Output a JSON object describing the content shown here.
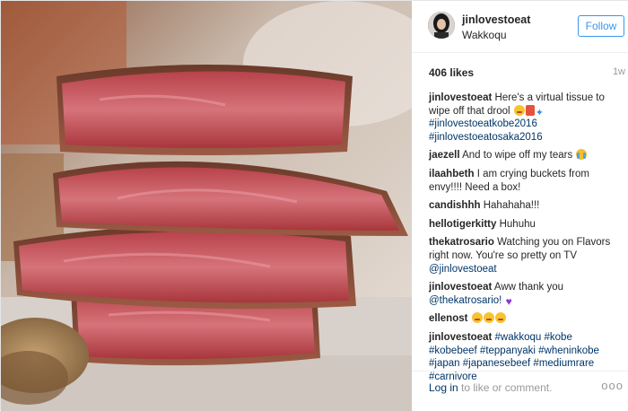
{
  "header": {
    "username": "jinlovestoeat",
    "location": "Wakkoqu",
    "follow_label": "Follow"
  },
  "stats": {
    "likes": "406 likes",
    "time_ago": "1w"
  },
  "caption": {
    "user": "jinlovestoeat",
    "text": "Here's a virtual tissue to wipe off that drool",
    "tags": [
      "#jinlovestoeatkobe2016",
      "#jinlovestoeatosaka2016"
    ]
  },
  "comments": [
    {
      "user": "jaezell",
      "text": "And to wipe off my tears"
    },
    {
      "user": "ilaahbeth",
      "text": "I am crying buckets from envy!!!! Need a box!"
    },
    {
      "user": "candishhh",
      "text": "Hahahaha!!!"
    },
    {
      "user": "hellotigerkitty",
      "text": "Huhuhu"
    },
    {
      "user": "thekatrosario",
      "text": "Watching you on Flavors right now. You're so pretty on TV",
      "mention": "@jinlovestoeat"
    },
    {
      "user": "jinlovestoeat",
      "text": "Aww thank you",
      "mention": "@thekatrosario!"
    },
    {
      "user": "ellenost",
      "text": ""
    },
    {
      "user": "jinlovestoeat",
      "tags": [
        "#wakkoqu",
        "#kobe",
        "#kobebeef",
        "#teppanyaki",
        "#wheninkobe",
        "#japan",
        "#japanesebeef",
        "#mediumrare",
        "#carnivore"
      ]
    }
  ],
  "footer": {
    "login_link": "Log in",
    "login_text": "to like or comment.",
    "more_label": "ooo"
  },
  "colors": {
    "accent": "#3897f0",
    "link": "#003569",
    "muted": "#999999"
  }
}
